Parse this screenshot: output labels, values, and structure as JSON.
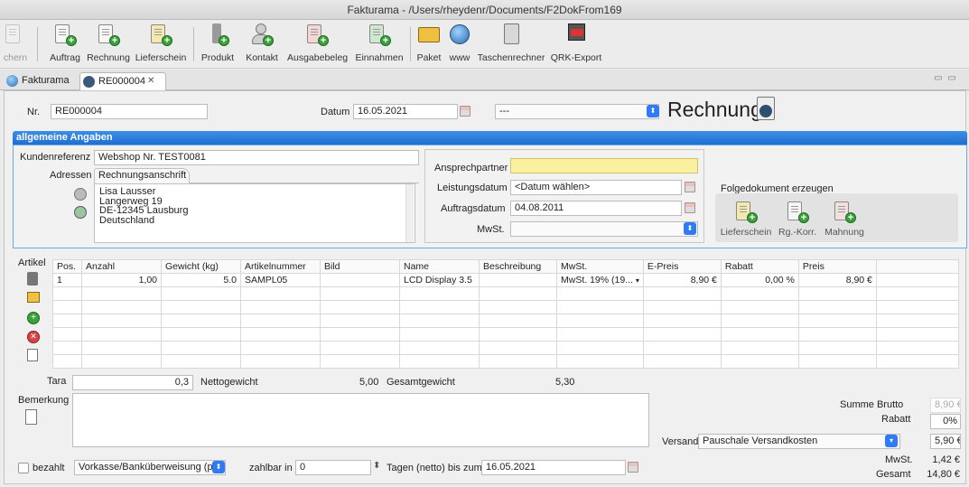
{
  "window": {
    "title": "Fakturama - /Users/rheydenr/Documents/F2DokFrom169"
  },
  "toolbar": {
    "save": "chern",
    "auftrag": "Auftrag",
    "rechnung": "Rechnung",
    "lieferschein": "Lieferschein",
    "produkt": "Produkt",
    "kontakt": "Kontakt",
    "ausgabebeleg": "Ausgabebeleg",
    "einnahmen": "Einnahmen",
    "paket": "Paket",
    "www": "www",
    "taschenrechner": "Taschenrechner",
    "qrk_export": "QRK-Export"
  },
  "tabs": [
    {
      "label": "Fakturama"
    },
    {
      "label": "RE000004"
    }
  ],
  "header": {
    "nr_label": "Nr.",
    "nr_value": "RE000004",
    "datum_label": "Datum",
    "datum_value": "16.05.2021",
    "status_value": "---",
    "doc_type": "Rechnung"
  },
  "general": {
    "title": "allgemeine Angaben",
    "kundenreferenz_label": "Kundenreferenz",
    "kundenreferenz_value": "Webshop Nr. TEST0081",
    "adressen_label": "Adressen",
    "address_tab": "Rechnungsanschrift",
    "address_lines": [
      "Lisa Lausser",
      "Langerweg 19",
      "DE-12345 Lausburg",
      "Deutschland"
    ],
    "ansprechpartner_label": "Ansprechpartner",
    "ansprechpartner_value": "",
    "leistungsdatum_label": "Leistungsdatum",
    "leistungsdatum_value": "<Datum wählen>",
    "auftragsdatum_label": "Auftragsdatum",
    "auftragsdatum_value": "04.08.2011",
    "mwst_label": "MwSt.",
    "mwst_value": "",
    "folge_label": "Folgedokument erzeugen",
    "folge_lieferschein": "Lieferschein",
    "folge_rgkorr": "Rg.-Korr.",
    "folge_mahnung": "Mahnung"
  },
  "items": {
    "label": "Artikel",
    "columns": [
      "Pos.",
      "Anzahl",
      "Gewicht (kg)",
      "Artikelnummer",
      "Bild",
      "Name",
      "Beschreibung",
      "MwSt.",
      "E-Preis",
      "Rabatt",
      "Preis"
    ],
    "rows": [
      {
        "pos": "1",
        "anzahl": "1,00",
        "gewicht": "5.0",
        "artnr": "SAMPL05",
        "bild": "",
        "name": "LCD Display 3.5",
        "beschreibung": "",
        "mwst": "MwSt. 19% (19...",
        "epreis": "8,90 €",
        "rabatt": "0,00 %",
        "preis": "8,90 €"
      }
    ]
  },
  "weights": {
    "tara_label": "Tara",
    "tara_value": "0,3",
    "netto_label": "Nettogewicht",
    "netto_value": "5,00",
    "gesamt_label": "Gesamtgewicht",
    "gesamt_value": "5,30"
  },
  "remarks": {
    "label": "Bemerkung",
    "value": ""
  },
  "totals": {
    "summe_brutto_label": "Summe Brutto",
    "summe_brutto_value": "8,90 €",
    "rabatt_label": "Rabatt",
    "rabatt_value": "0%",
    "versand_label": "Versand",
    "versand_value": "Pauschale Versandkosten",
    "versand_amount": "5,90 €",
    "mwst_label": "MwSt.",
    "mwst_value": "1,42 €",
    "gesamt_label": "Gesamt",
    "gesamt_value": "14,80 €"
  },
  "payment": {
    "bezahlt_label": "bezahlt",
    "method_value": "Vorkasse/Banküberweisung (pre",
    "zahlbar_label": "zahlbar in",
    "zahlbar_value": "0",
    "tagen_label": "Tagen (netto) bis zum",
    "due_date": "16.05.2021"
  },
  "colors": {
    "accent": "#2f7bf5",
    "panel_header": "#1f6fd1",
    "highlight_field": "#fbf0a0"
  }
}
